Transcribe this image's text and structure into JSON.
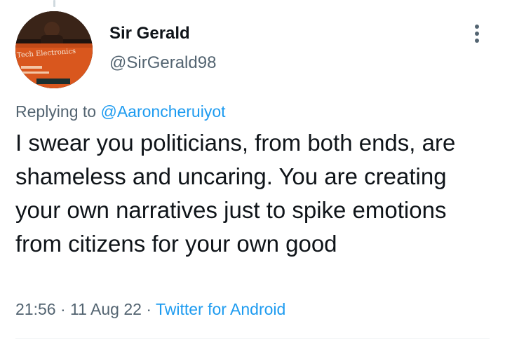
{
  "tweet": {
    "author": {
      "display_name": "Sir Gerald",
      "handle": "@SirGerald98",
      "avatar_text": "Tech Electronics"
    },
    "reply": {
      "prefix": "Replying to",
      "mention": "@Aaroncheruiyot"
    },
    "text": "I swear you politicians, from both ends, are shameless and uncaring. You are creating your own narratives just to spike emotions from citizens for your own good",
    "meta": {
      "time": "21:56",
      "date": "11 Aug 22",
      "separator": "·",
      "source": "Twitter for Android"
    }
  },
  "icons": {
    "more": "more-vertical-icon"
  },
  "colors": {
    "text": "#0f1419",
    "secondary": "#536471",
    "link": "#1d9bf0"
  }
}
